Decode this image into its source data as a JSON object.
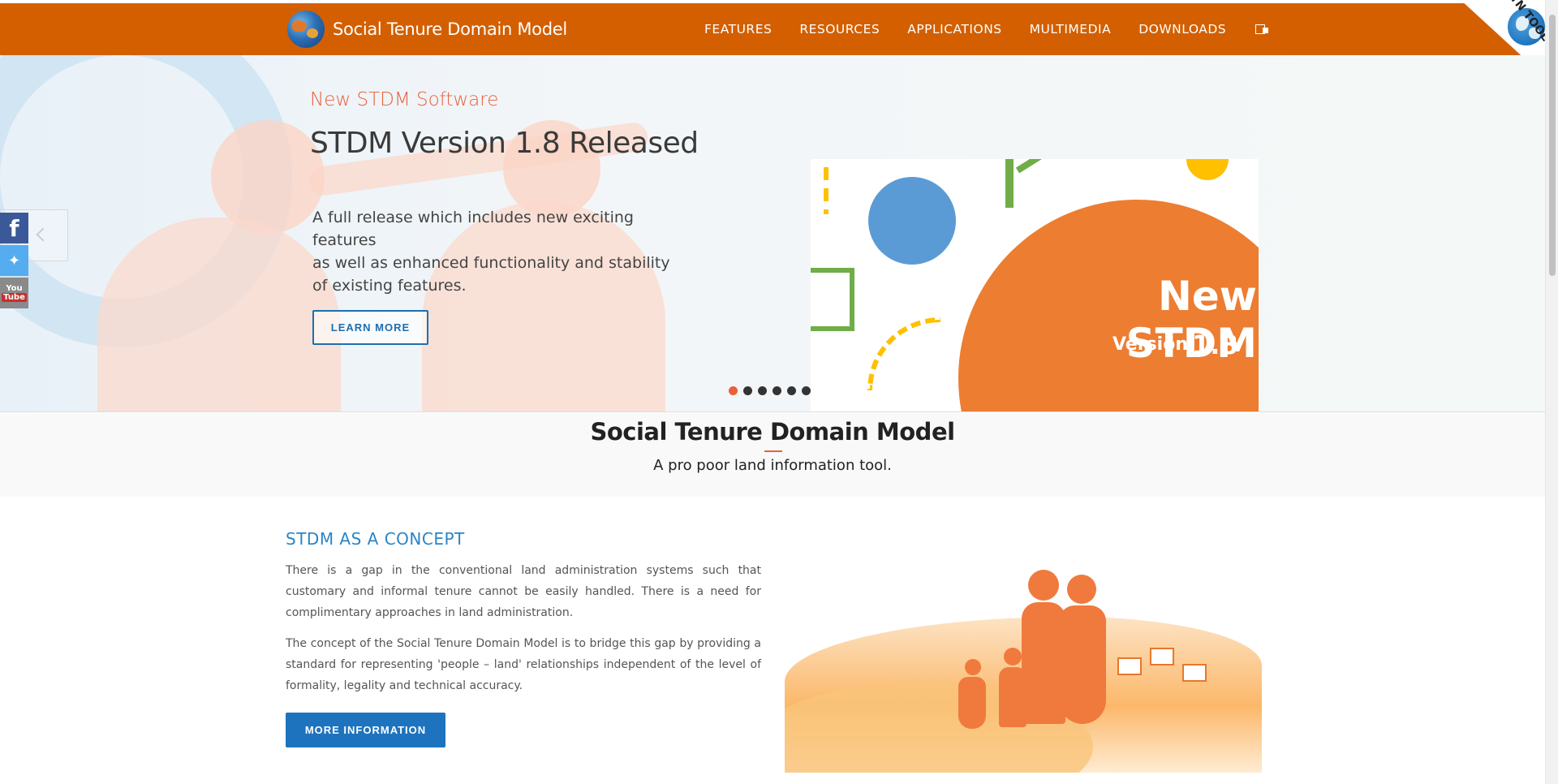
{
  "brand": {
    "title": "Social Tenure Domain Model"
  },
  "nav": {
    "items": [
      "FEATURES",
      "RESOURCES",
      "APPLICATIONS",
      "MULTIMEDIA",
      "DOWNLOADS"
    ]
  },
  "corner": {
    "label": "A GLTN TOOL"
  },
  "hero": {
    "subtitle": "New STDM Software",
    "title": "STDM Version 1.8 Released",
    "description_lines": [
      "A full release which includes new exciting features",
      "as well as enhanced functionality and stability",
      "of existing features."
    ],
    "button": "LEARN MORE",
    "art": {
      "headline": "New STDM",
      "version_label": "Version",
      "version_number": "1.8"
    },
    "slides": {
      "count": 6,
      "active": 1
    }
  },
  "social": {
    "facebook": "f",
    "youtube_top": "You",
    "youtube_bottom": "Tube"
  },
  "intro": {
    "title": "Social Tenure Domain Model",
    "subtitle": "A pro poor land information tool."
  },
  "concept": {
    "title": "STDM AS A CONCEPT",
    "paragraph1": "There is a gap in the conventional land administration systems such that customary and informal tenure cannot be easily handled. There is a need for complimentary approaches in land administration.",
    "paragraph2": "The concept of the Social Tenure Domain Model is to bridge this gap by providing a standard for representing 'people – land' relationships independent of the level of formality, legality and technical accuracy.",
    "button": "MORE INFORMATION"
  },
  "colors": {
    "nav_bg": "#d35f00",
    "accent_red": "#e9603b",
    "primary_blue": "#1e73be"
  },
  "icons": [
    "globe-logo-icon",
    "language-icon",
    "facebook-icon",
    "twitter-icon",
    "youtube-icon",
    "chevron-left-icon"
  ]
}
